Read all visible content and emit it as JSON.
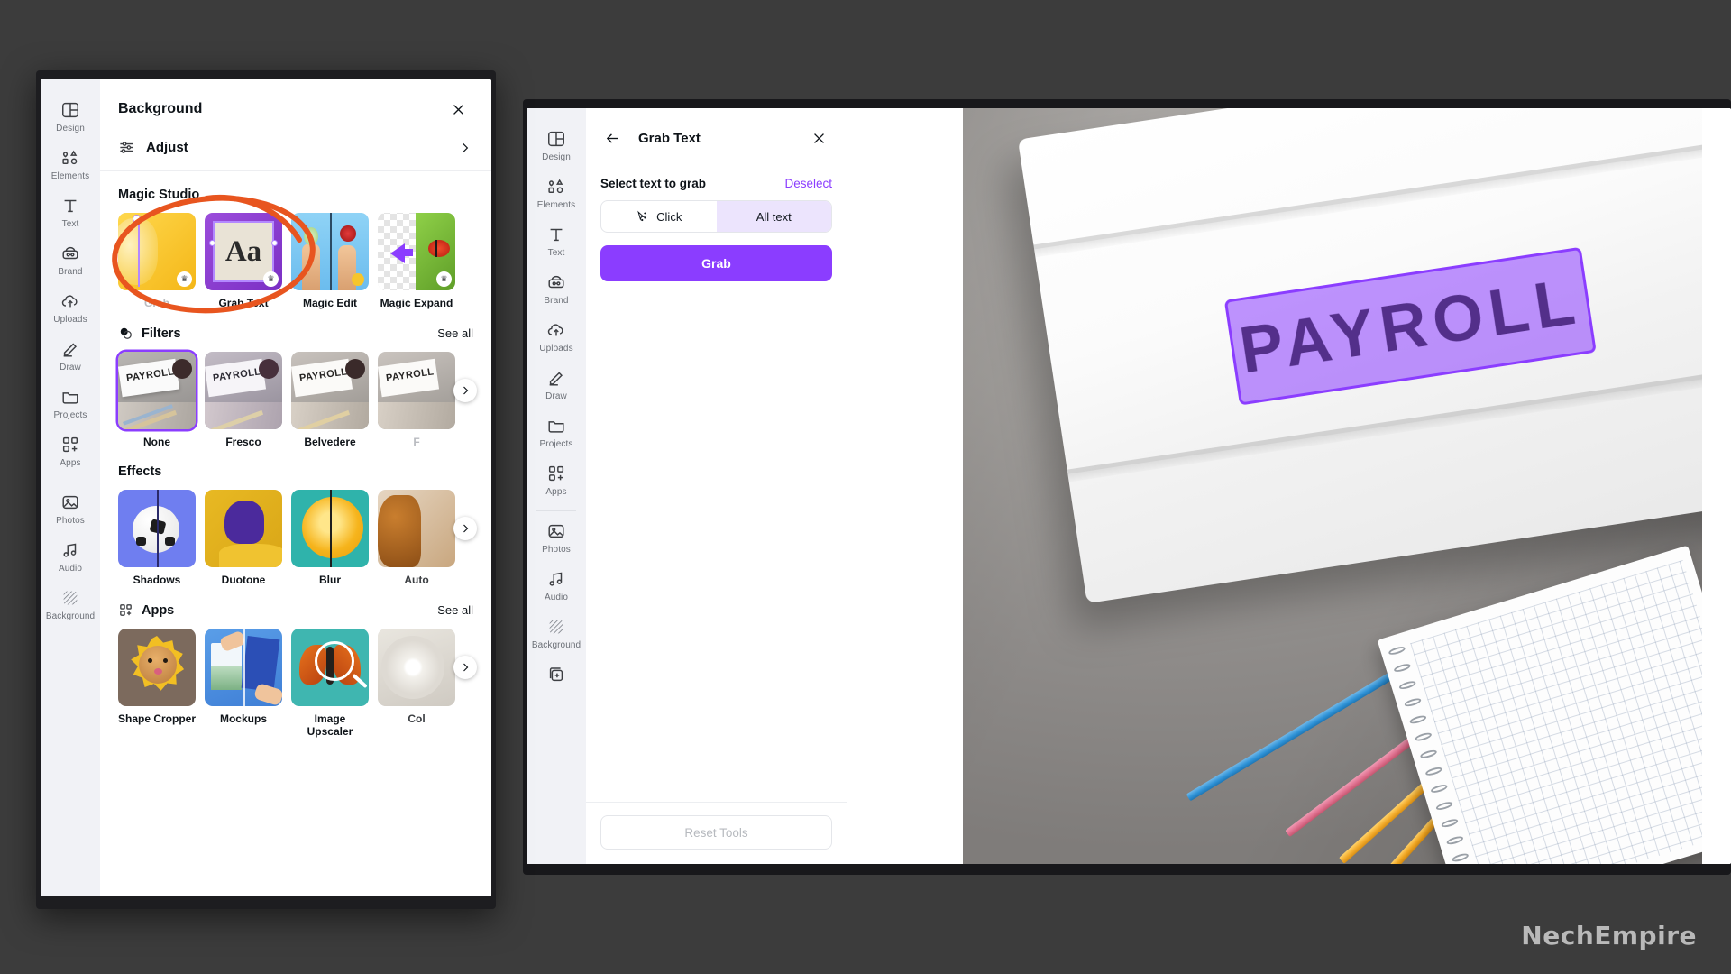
{
  "watermark": "NechEmpire",
  "front_window": {
    "rail": {
      "items": [
        {
          "label": "Design",
          "icon": "design-icon"
        },
        {
          "label": "Elements",
          "icon": "elements-icon"
        },
        {
          "label": "Text",
          "icon": "text-icon"
        },
        {
          "label": "Brand",
          "icon": "brand-icon"
        },
        {
          "label": "Uploads",
          "icon": "uploads-icon"
        },
        {
          "label": "Draw",
          "icon": "draw-icon"
        },
        {
          "label": "Projects",
          "icon": "projects-icon"
        },
        {
          "label": "Apps",
          "icon": "apps-icon"
        }
      ],
      "items_secondary": [
        {
          "label": "Photos",
          "icon": "photos-icon"
        },
        {
          "label": "Audio",
          "icon": "audio-icon"
        },
        {
          "label": "Background",
          "icon": "background-icon"
        }
      ]
    },
    "panel": {
      "title": "Background",
      "close_label": "✕",
      "adjust_label": "Adjust",
      "sections": {
        "magic_studio": {
          "title": "Magic Studio",
          "items": [
            {
              "label": "Grab",
              "pro": true
            },
            {
              "label": "Grab Text",
              "pro": true
            },
            {
              "label": "Magic Edit",
              "pro": true
            },
            {
              "label": "Magic Expand",
              "pro": true
            }
          ]
        },
        "filters": {
          "title": "Filters",
          "see_all": "See all",
          "items": [
            {
              "label": "None",
              "selected": true
            },
            {
              "label": "Fresco",
              "selected": false
            },
            {
              "label": "Belvedere",
              "selected": false
            },
            {
              "label": "F",
              "selected": false
            }
          ]
        },
        "effects": {
          "title": "Effects",
          "items": [
            {
              "label": "Shadows"
            },
            {
              "label": "Duotone"
            },
            {
              "label": "Blur"
            },
            {
              "label": "Auto"
            }
          ]
        },
        "apps": {
          "title": "Apps",
          "see_all": "See all",
          "items": [
            {
              "label": "Shape Cropper"
            },
            {
              "label": "Mockups"
            },
            {
              "label": "Image Upscaler"
            },
            {
              "label": "Col"
            }
          ]
        }
      }
    }
  },
  "back_window": {
    "rail": {
      "items": [
        {
          "label": "Design",
          "icon": "design-icon"
        },
        {
          "label": "Elements",
          "icon": "elements-icon"
        },
        {
          "label": "Text",
          "icon": "text-icon"
        },
        {
          "label": "Brand",
          "icon": "brand-icon"
        },
        {
          "label": "Uploads",
          "icon": "uploads-icon"
        },
        {
          "label": "Draw",
          "icon": "draw-icon"
        },
        {
          "label": "Projects",
          "icon": "projects-icon"
        },
        {
          "label": "Apps",
          "icon": "apps-icon"
        }
      ],
      "items_secondary": [
        {
          "label": "Photos",
          "icon": "photos-icon"
        },
        {
          "label": "Audio",
          "icon": "audio-icon"
        },
        {
          "label": "Background",
          "icon": "background-icon"
        }
      ]
    },
    "grab_text": {
      "title": "Grab Text",
      "back_label": "←",
      "close_label": "✕",
      "select_label": "Select text to grab",
      "deselect_label": "Deselect",
      "modes": [
        {
          "label": "Click",
          "active": false,
          "icon": "cursor-sparkle-icon"
        },
        {
          "label": "All text",
          "active": true,
          "icon": ""
        }
      ],
      "grab_button": "Grab",
      "reset_button": "Reset Tools"
    },
    "canvas": {
      "selection_text": "PAYROLL"
    }
  },
  "colors": {
    "accent_purple": "#8b3dff",
    "selection_fill": "rgba(139,61,255,0.55)",
    "annotation_orange": "#e8551f",
    "rail_bg": "#f1f2f6",
    "panel_bg": "#ffffff",
    "window_chrome": "#1d1d20",
    "desktop_bg": "#3c3c3c"
  }
}
